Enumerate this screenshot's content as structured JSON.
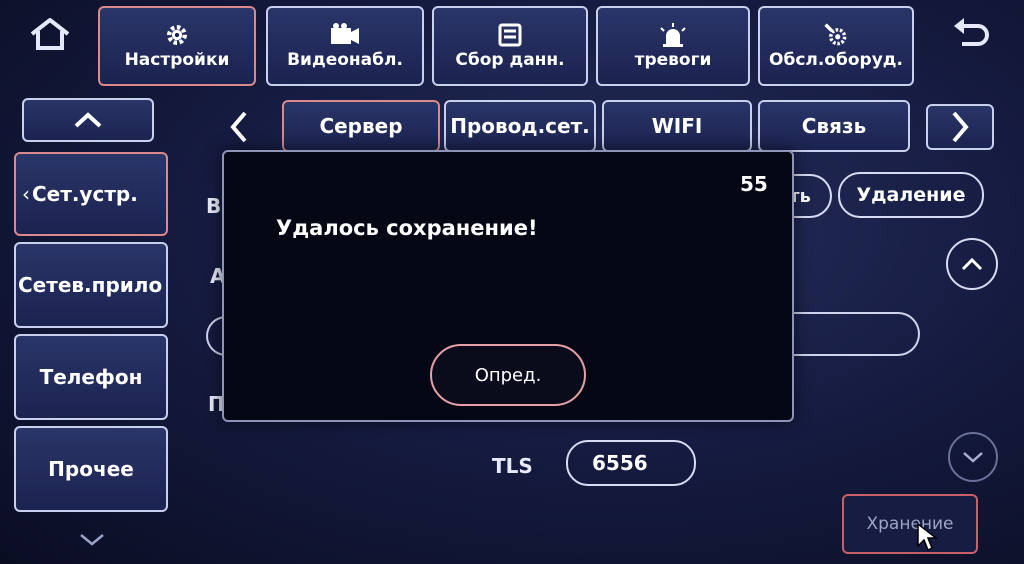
{
  "top_nav": {
    "home_icon": "home-icon",
    "items": [
      {
        "label": "Настройки",
        "icon": "gear-icon"
      },
      {
        "label": "Видеонабл.",
        "icon": "camera-icon"
      },
      {
        "label": "Сбор данн.",
        "icon": "data-icon"
      },
      {
        "label": "тревоги",
        "icon": "alarm-icon"
      },
      {
        "label": "Обсл.оборуд.",
        "icon": "maintenance-icon"
      }
    ],
    "back_icon": "back-arrow-icon"
  },
  "tabs": [
    "Сервер",
    "Провод.сет.",
    "WIFI",
    "Связь"
  ],
  "sidebar": {
    "items": [
      {
        "label": "Сет.устр."
      },
      {
        "label": "Сетев.прило"
      },
      {
        "label": "Телефон"
      },
      {
        "label": "Прочее"
      }
    ]
  },
  "form": {
    "right_button_partial": "ть",
    "delete_label": "Удаление",
    "tls_label": "TLS",
    "tls_value": "6556",
    "save_label": "Хранение",
    "letter_b": "В",
    "letter_a": "A",
    "letter_p": "П"
  },
  "dialog": {
    "countdown": "55",
    "message": "Удалось сохранение!",
    "ok_label": "Опред."
  },
  "colors": {
    "accent_red": "#d98a8a",
    "dialog_ok_border": "#e8a0a8"
  }
}
